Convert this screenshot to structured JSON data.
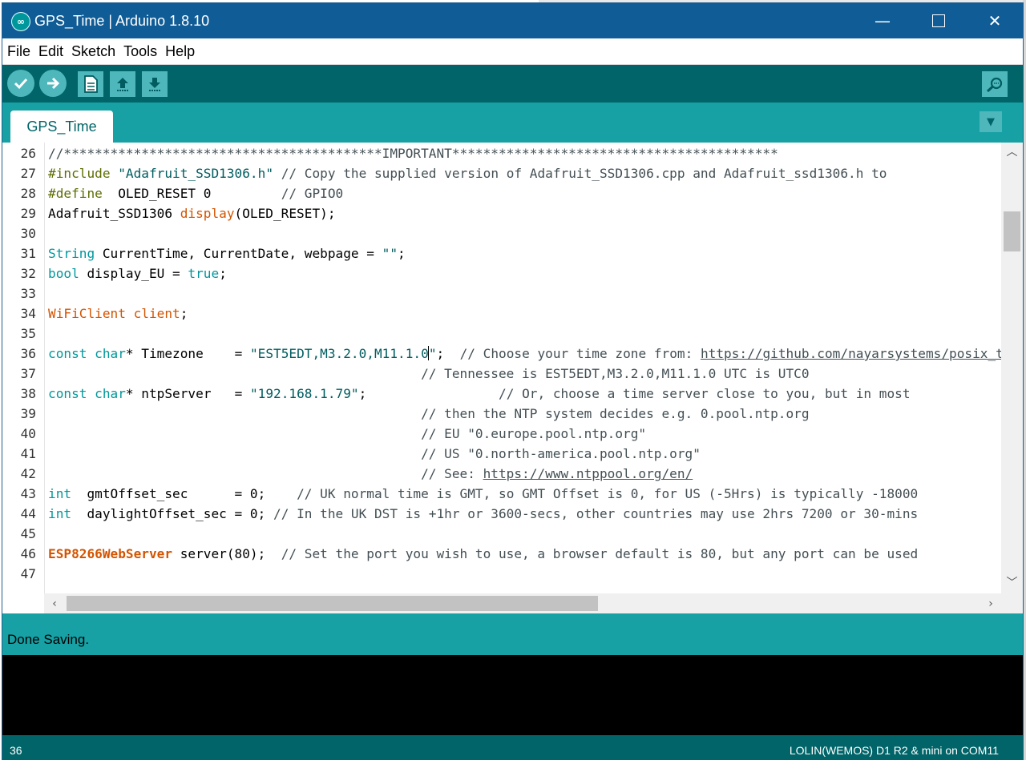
{
  "window": {
    "title": "GPS_Time | Arduino 1.8.10",
    "minimize_glyph": "—",
    "close_glyph": "✕"
  },
  "menu": [
    "File",
    "Edit",
    "Sketch",
    "Tools",
    "Help"
  ],
  "toolbar": {
    "buttons": [
      "verify-icon",
      "upload-icon",
      "new-icon",
      "open-icon",
      "save-icon"
    ],
    "serial_monitor": "serial-monitor-icon"
  },
  "tabs": [
    {
      "label": "GPS_Time"
    }
  ],
  "tab_menu_glyph": "▼",
  "editor": {
    "cursor_line": 36,
    "lines": [
      {
        "n": "26",
        "segs": [
          [
            "cm",
            "//*****************************************IMPORTANT******************************************"
          ]
        ]
      },
      {
        "n": "27",
        "segs": [
          [
            "pp",
            "#include"
          ],
          [
            "",
            " "
          ],
          [
            "str",
            "\"Adafruit_SSD1306.h\""
          ],
          [
            "cm",
            " // Copy the supplied version of Adafruit_SSD1306.cpp and Adafruit_ssd1306.h to"
          ]
        ]
      },
      {
        "n": "28",
        "segs": [
          [
            "pp",
            "#define"
          ],
          [
            "",
            "  OLED_RESET 0         "
          ],
          [
            "cm",
            "// GPIO0"
          ]
        ]
      },
      {
        "n": "29",
        "segs": [
          [
            "",
            "Adafruit_SSD1306 "
          ],
          [
            "fn",
            "display"
          ],
          [
            "",
            "(OLED_RESET);"
          ]
        ]
      },
      {
        "n": "30",
        "segs": []
      },
      {
        "n": "31",
        "segs": [
          [
            "kw",
            "String"
          ],
          [
            "",
            " CurrentTime, CurrentDate, webpage = "
          ],
          [
            "str",
            "\"\""
          ],
          [
            "",
            ";"
          ]
        ]
      },
      {
        "n": "32",
        "segs": [
          [
            "kw",
            "bool"
          ],
          [
            "",
            " display_EU = "
          ],
          [
            "kw",
            "true"
          ],
          [
            "",
            ";"
          ]
        ]
      },
      {
        "n": "33",
        "segs": []
      },
      {
        "n": "34",
        "segs": [
          [
            "fn",
            "WiFiClient"
          ],
          [
            "",
            " "
          ],
          [
            "fn",
            "client"
          ],
          [
            "",
            ";"
          ]
        ]
      },
      {
        "n": "35",
        "segs": []
      },
      {
        "n": "36",
        "segs": [
          [
            "kw",
            "const"
          ],
          [
            "",
            " "
          ],
          [
            "kw",
            "char"
          ],
          [
            "",
            "* Timezone    = "
          ],
          [
            "str",
            "\"EST5EDT,M3.2.0,M11.1.0"
          ],
          [
            "caret",
            ""
          ],
          [
            "str",
            "\""
          ],
          [
            "",
            ";  "
          ],
          [
            "cm",
            "// Choose your time zone from: "
          ],
          [
            "url",
            "https://github.com/nayarsystems/posix_tz_db"
          ]
        ]
      },
      {
        "n": "37",
        "segs": [
          [
            "",
            "                                                "
          ],
          [
            "cm",
            "// Tennessee is EST5EDT,M3.2.0,M11.1.0 UTC is UTC0"
          ]
        ]
      },
      {
        "n": "38",
        "segs": [
          [
            "kw",
            "const"
          ],
          [
            "",
            " "
          ],
          [
            "kw",
            "char"
          ],
          [
            "",
            "* ntpServer   = "
          ],
          [
            "str",
            "\"192.168.1.79\""
          ],
          [
            "",
            ";                 "
          ],
          [
            "cm",
            "// Or, choose a time server close to you, but in most"
          ]
        ]
      },
      {
        "n": "39",
        "segs": [
          [
            "",
            "                                                "
          ],
          [
            "cm",
            "// then the NTP system decides e.g. 0.pool.ntp.org"
          ]
        ]
      },
      {
        "n": "40",
        "segs": [
          [
            "",
            "                                                "
          ],
          [
            "cm",
            "// EU \"0.europe.pool.ntp.org\""
          ]
        ]
      },
      {
        "n": "41",
        "segs": [
          [
            "",
            "                                                "
          ],
          [
            "cm",
            "// US \"0.north-america.pool.ntp.org\""
          ]
        ]
      },
      {
        "n": "42",
        "segs": [
          [
            "",
            "                                                "
          ],
          [
            "cm",
            "// See: "
          ],
          [
            "url",
            "https://www.ntppool.org/en/"
          ]
        ]
      },
      {
        "n": "43",
        "segs": [
          [
            "kw",
            "int"
          ],
          [
            "",
            "  gmtOffset_sec      = 0;    "
          ],
          [
            "cm",
            "// UK normal time is GMT, so GMT Offset is 0, for US (-5Hrs) is typically -18000"
          ]
        ]
      },
      {
        "n": "44",
        "segs": [
          [
            "kw",
            "int"
          ],
          [
            "",
            "  daylightOffset_sec = 0; "
          ],
          [
            "cm",
            "// In the UK DST is +1hr or 3600-secs, other countries may use 2hrs 7200 or 30-mins"
          ]
        ]
      },
      {
        "n": "45",
        "segs": []
      },
      {
        "n": "46",
        "segs": [
          [
            "cls",
            "ESP8266WebServer"
          ],
          [
            "",
            " server(80);  "
          ],
          [
            "cm",
            "// Set the port you wish to use, a browser default is 80, but any port can be used"
          ]
        ]
      },
      {
        "n": "47",
        "segs": []
      }
    ]
  },
  "scroll": {
    "up": "︿",
    "down": "﹀",
    "left": "‹",
    "right": "›"
  },
  "status": {
    "message": "Done Saving."
  },
  "footer": {
    "line": "36",
    "board": "LOLIN(WEMOS) D1 R2 & mini on COM11"
  }
}
